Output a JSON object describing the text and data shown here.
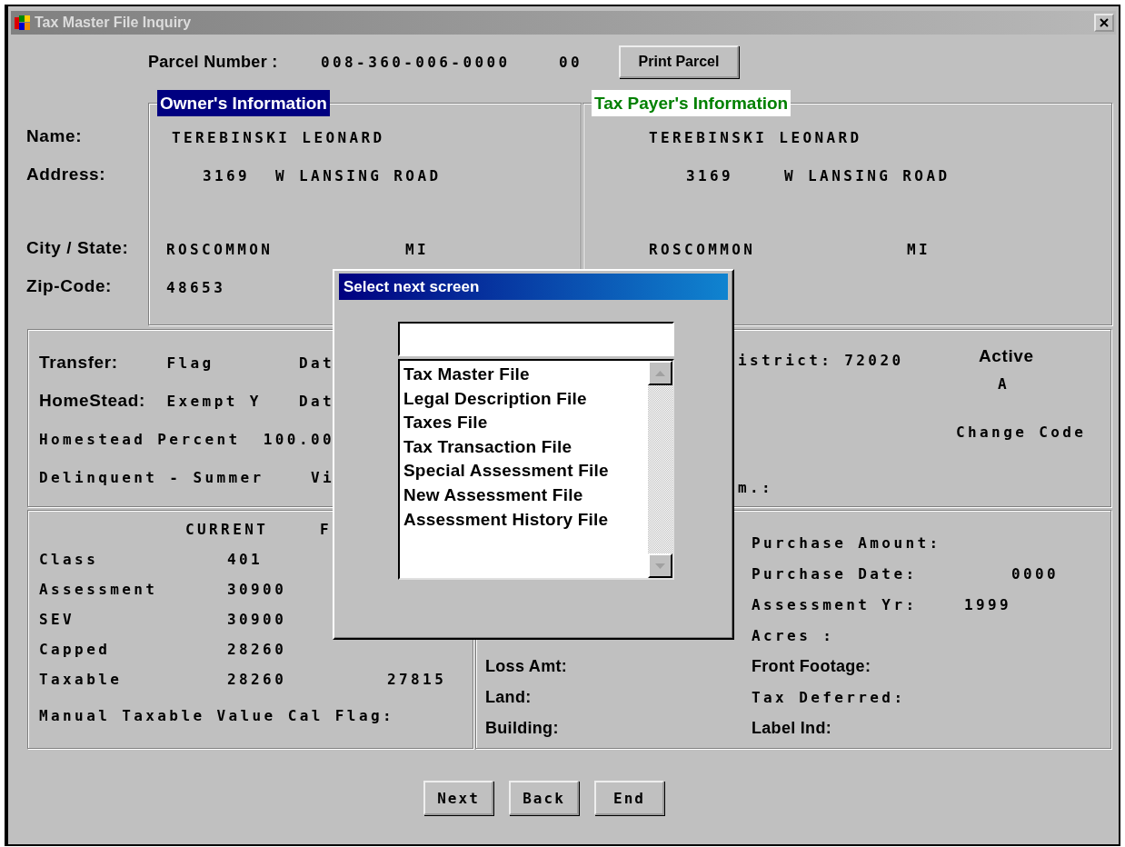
{
  "window": {
    "title": "Tax Master File Inquiry"
  },
  "parcel": {
    "label": "Parcel Number :",
    "number": "008-360-006-0000",
    "suffix": "00",
    "print_button": {
      "label": "Print Parcel"
    }
  },
  "address_labels": [
    "Name:",
    "Address:",
    "City / State:",
    "Zip-Code:"
  ],
  "owner": {
    "legend": "Owner's Information",
    "name": "TEREBINSKI LEONARD",
    "street_number": "3169",
    "street": "W LANSING ROAD",
    "city": "ROSCOMMON",
    "state": "MI",
    "zip": "48653"
  },
  "tax_payer": {
    "legend": "Tax Payer's Information",
    "name": "TEREBINSKI LEONARD",
    "street_number": "3169",
    "street": "W LANSING ROAD",
    "city": "ROSCOMMON",
    "state": "MI"
  },
  "transfer_panel": {
    "rows": [
      {
        "label": "Transfer:",
        "value": "Flag",
        "column_3": "Dat"
      },
      {
        "label": "HomeStead:",
        "value": "Exempt Y",
        "column_3": "Dat"
      },
      {
        "label": "Homestead Percent",
        "value": "100.00"
      },
      {
        "label": "Delinquent - Summer",
        "column_3": "Vi"
      }
    ],
    "district": "istrict: 72020",
    "active_label": "Active",
    "active_value": "A",
    "change_code_label": "Change Code",
    "column_4": "m.:"
  },
  "values_panel": {
    "header": "CURRENT",
    "header_2": "F",
    "rows": [
      {
        "label": "Class",
        "current": "401"
      },
      {
        "label": "Assessment",
        "current": "30900"
      },
      {
        "label": "SEV",
        "current": "30900"
      },
      {
        "label": "Capped",
        "current": "28260"
      },
      {
        "label": "Taxable",
        "current": "28260",
        "column_3": "27815"
      }
    ],
    "manual_flag_label": "Manual Taxable Value Cal Flag:"
  },
  "purchase_panel": {
    "left_rows": [
      "Loss Amt:",
      "Land:",
      "Building:"
    ],
    "right_rows": [
      {
        "label": "Purchase Amount:"
      },
      {
        "label": "Purchase Date:",
        "value": "0000"
      },
      {
        "label": "Assessment Yr:",
        "value": "1999"
      },
      {
        "label": "Acres :"
      },
      {
        "label": "Front Footage:"
      },
      {
        "label": "Tax Deferred:"
      },
      {
        "label": "Label Ind:"
      }
    ]
  },
  "buttons": [
    {
      "label": "Next"
    },
    {
      "label": "Back"
    },
    {
      "label": "End"
    }
  ],
  "dialog": {
    "title": "Select next screen",
    "items": [
      {
        "label": "Tax Master File",
        "selected": false
      },
      {
        "label": "Legal Description File",
        "selected": false
      },
      {
        "label": "Taxes File",
        "selected": false
      },
      {
        "label": "Tax Transaction File",
        "selected": false
      },
      {
        "label": "Special Assessment File",
        "selected": false
      },
      {
        "label": "New Assessment File",
        "selected": false
      },
      {
        "label": "Assessment History File",
        "selected": false
      }
    ]
  }
}
